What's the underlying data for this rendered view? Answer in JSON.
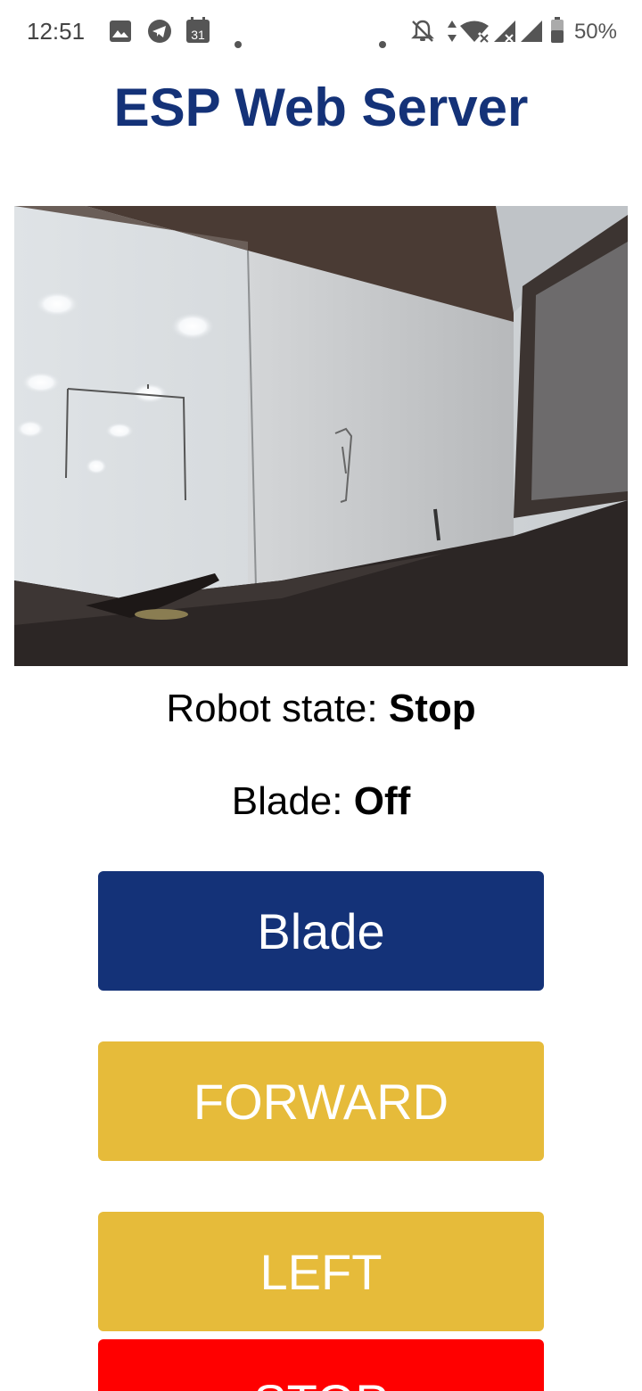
{
  "status_bar": {
    "time": "12:51",
    "calendar_day": "31",
    "battery_percent": "50%",
    "icons": [
      "image-icon",
      "telegram-icon",
      "calendar-icon",
      "dot-icon",
      "dot-icon",
      "bell-off-icon",
      "data-arrows-icon",
      "wifi-off-icon",
      "signal-icon",
      "signal-icon",
      "battery-icon"
    ]
  },
  "page": {
    "title": "ESP Web Server"
  },
  "robot": {
    "state_label": "Robot state:",
    "state_value": "Stop",
    "blade_label": "Blade:",
    "blade_value": "Off"
  },
  "buttons": {
    "blade": "Blade",
    "forward": "FORWARD",
    "left": "LEFT",
    "stop": "STOP"
  },
  "colors": {
    "title": "#143278",
    "blade_button": "#143278",
    "move_button": "#e6bb3a",
    "stop_button": "#ff0000"
  }
}
